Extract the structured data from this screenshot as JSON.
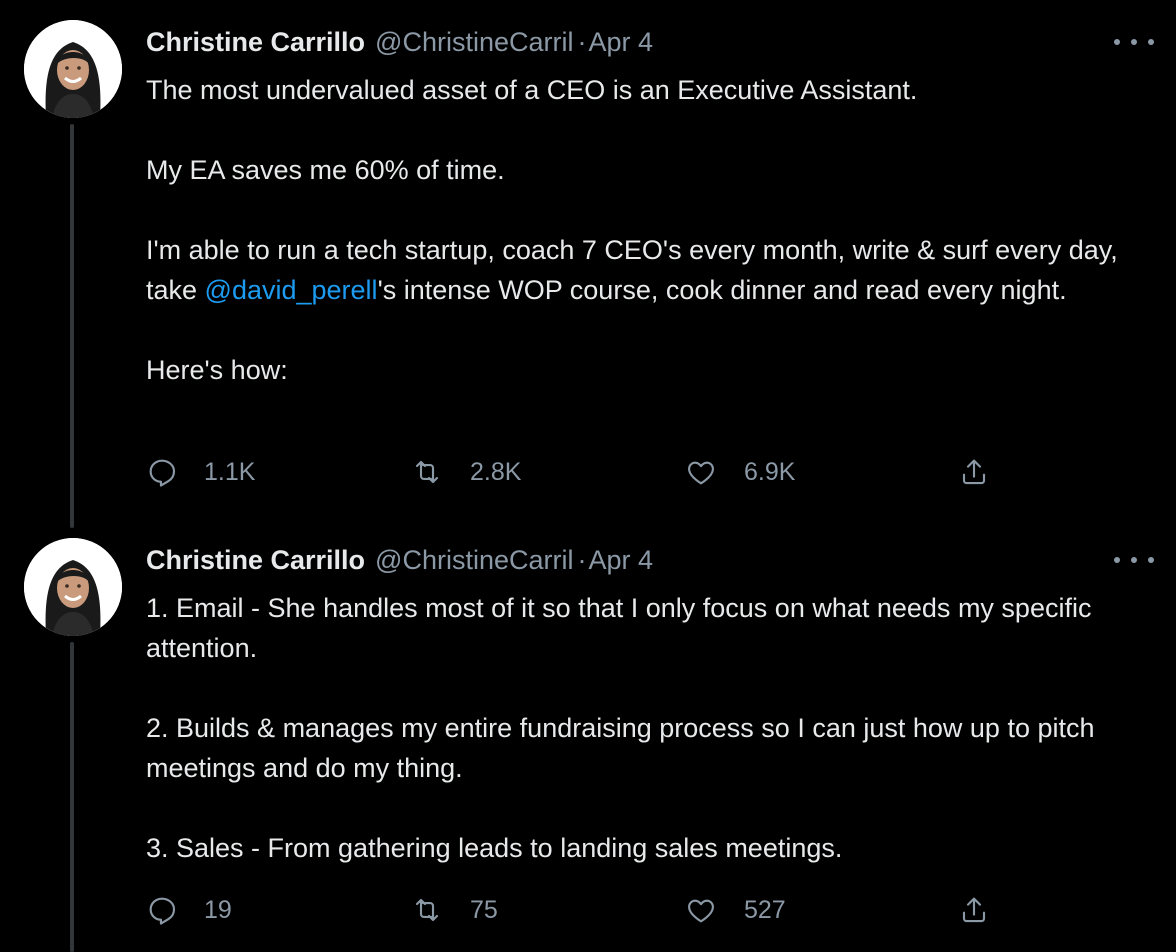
{
  "tweets": [
    {
      "author_name": "Christine Carrillo",
      "handle": "@ChristineCarril",
      "separator": "·",
      "date": "Apr 4",
      "paragraphs": [
        "The most undervalued asset of a CEO is an Executive Assistant.",
        "My EA saves me 60% of time.",
        "Here's how:"
      ],
      "p3_before": "I'm able to run a tech startup, coach 7 CEO's every month, write & surf every day, take ",
      "p3_mention": "@david_perell",
      "p3_after": "'s intense WOP course, cook dinner and read every night.",
      "replies": "1.1K",
      "retweets": "2.8K",
      "likes": "6.9K"
    },
    {
      "author_name": "Christine Carrillo",
      "handle": "@ChristineCarril",
      "separator": "·",
      "date": "Apr 4",
      "paragraphs": [
        "1. Email - She handles most of it so that I only focus on what needs my specific attention.",
        "2. Builds & manages my entire fundraising process so I can just how up to pitch meetings and do my thing.",
        "3. Sales - From gathering leads to landing sales meetings."
      ],
      "replies": "19",
      "retweets": "75",
      "likes": "527"
    }
  ],
  "icons": {
    "reply": "reply-icon",
    "retweet": "retweet-icon",
    "like": "heart-icon",
    "share": "share-icon",
    "more": "more-options-icon"
  },
  "colors": {
    "background": "#000000",
    "text": "#e7e9ea",
    "muted": "#8b98a5",
    "link": "#1d9bf0",
    "thread_line": "#333639"
  }
}
